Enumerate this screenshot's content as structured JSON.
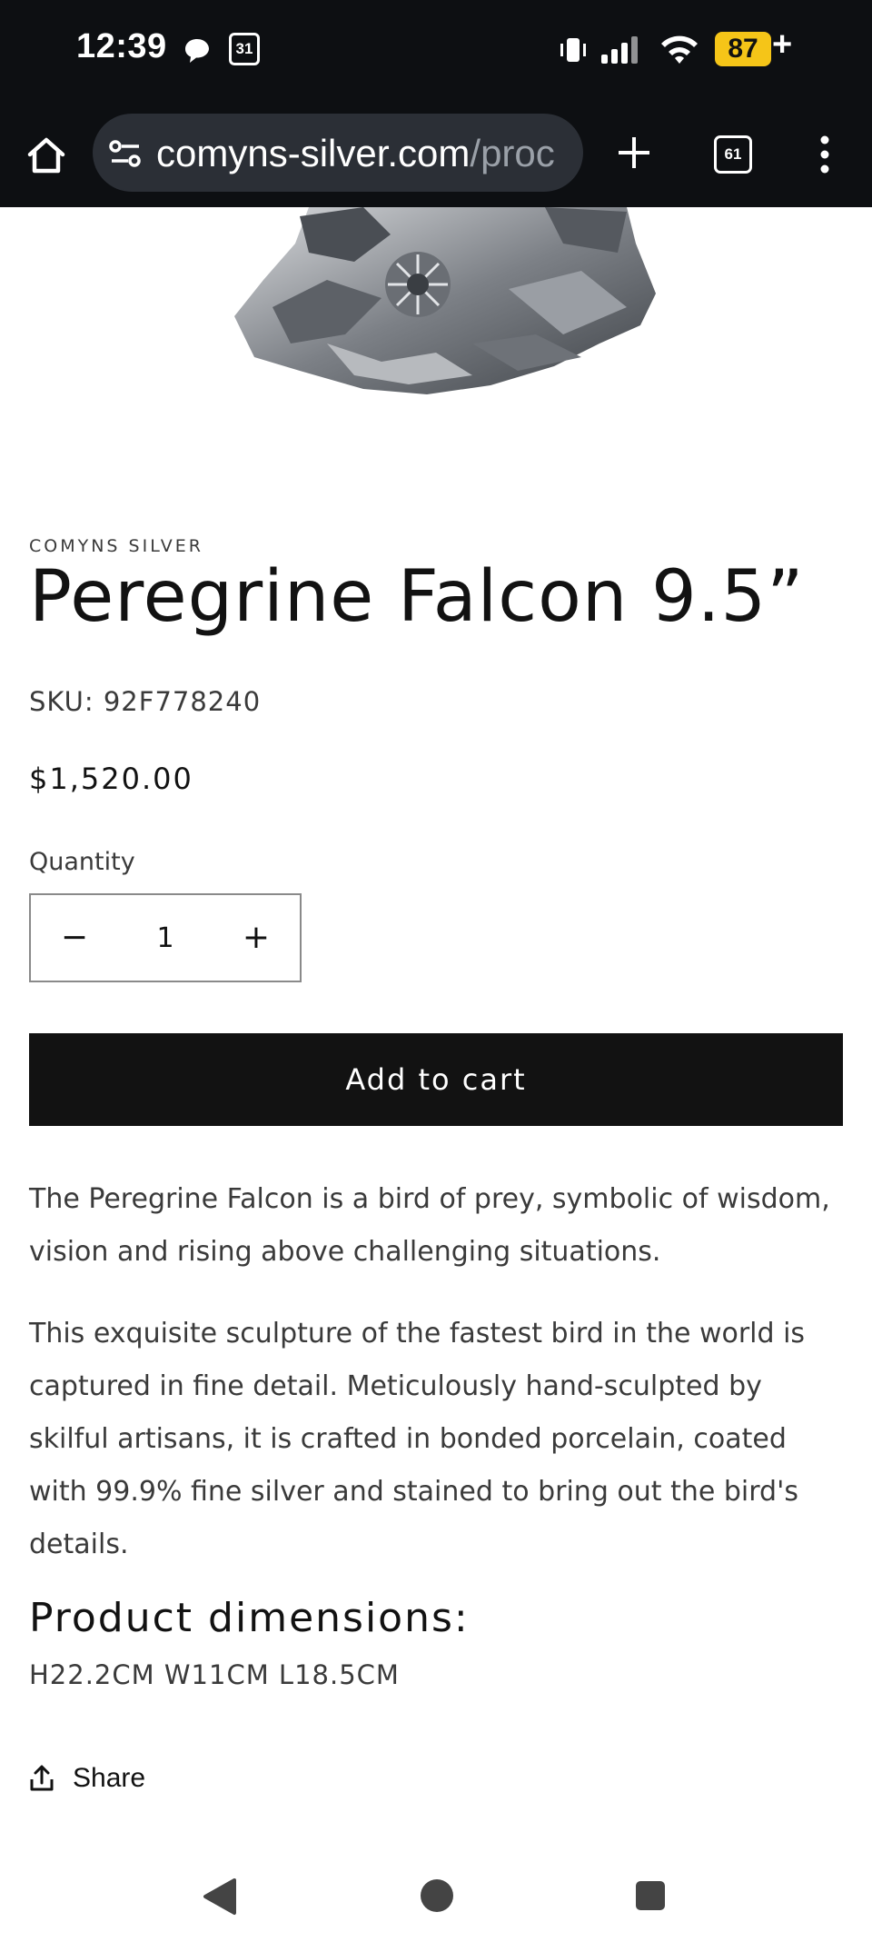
{
  "status_bar": {
    "time": "12:39",
    "calendar_day": "31",
    "battery": "87",
    "battery_charging": "+"
  },
  "browser": {
    "url_host": "comyns-silver.com",
    "url_path": "/proc",
    "tab_count": "61"
  },
  "product": {
    "vendor": "COMYNS SILVER",
    "title": "Peregrine Falcon 9.5”",
    "sku": "SKU: 92F778240",
    "price": "$1,520.00",
    "quantity_label": "Quantity",
    "quantity_value": "1",
    "minus_label": "−",
    "plus_label": "+",
    "add_to_cart_label": "Add to cart",
    "description": [
      "The Peregrine Falcon is a bird of prey, symbolic of wisdom, vision and rising above challenging situations.",
      "This exquisite sculpture of the fastest bird in the world is captured in fine detail. Meticulously hand-sculpted by skilful artisans, it is crafted in bonded porcelain, coated with 99.9% fine silver and stained to bring out the bird's details."
    ],
    "dimensions_heading": "Product dimensions:",
    "dimensions_value": "H22.2CM W11CM L18.5CM",
    "share_label": "Share"
  },
  "colors": {
    "dark_bar": "#0d0f12",
    "button_bg": "#121212",
    "battery": "#f5c518"
  }
}
